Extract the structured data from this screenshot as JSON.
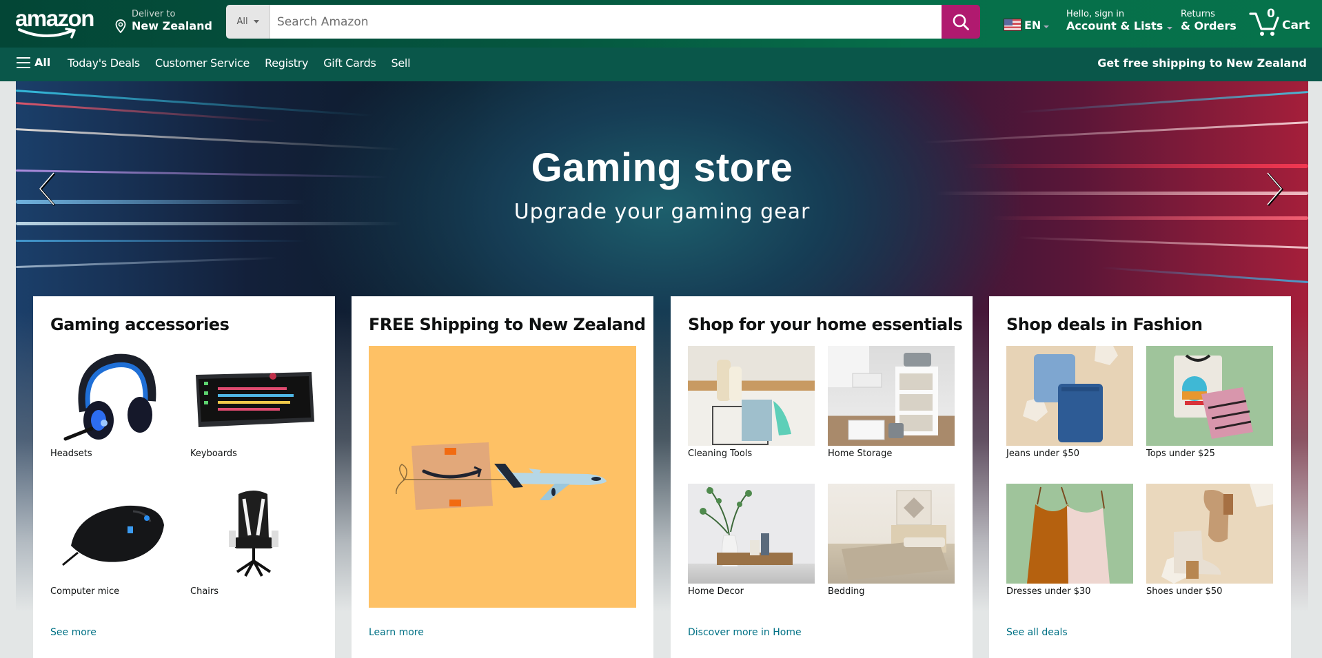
{
  "header": {
    "logo_text": "amazon",
    "deliver_line1": "Deliver to",
    "deliver_line2": "New Zealand",
    "search_category": "All",
    "search_placeholder": "Search Amazon",
    "search_value": "",
    "language": "EN",
    "account_line1": "Hello, sign in",
    "account_line2": "Account & Lists",
    "returns_line1": "Returns",
    "returns_line2": "& Orders",
    "cart_count": "0",
    "cart_label": "Cart"
  },
  "nav": {
    "all_label": "All",
    "links": [
      "Today's Deals",
      "Customer Service",
      "Registry",
      "Gift Cards",
      "Sell"
    ],
    "promo": "Get free shipping to New Zealand"
  },
  "hero": {
    "title": "Gaming store",
    "subtitle": "Upgrade your gaming gear"
  },
  "cards": [
    {
      "title": "Gaming accessories",
      "items": [
        {
          "label": "Headsets"
        },
        {
          "label": "Keyboards"
        },
        {
          "label": "Computer mice"
        },
        {
          "label": "Chairs"
        }
      ],
      "link": "See more"
    },
    {
      "title": "FREE Shipping to New Zealand",
      "link": "Learn more"
    },
    {
      "title": "Shop for your home essentials",
      "items": [
        {
          "label": "Cleaning Tools"
        },
        {
          "label": "Home Storage"
        },
        {
          "label": "Home Decor"
        },
        {
          "label": "Bedding"
        }
      ],
      "link": "Discover more in Home"
    },
    {
      "title": "Shop deals in Fashion",
      "items": [
        {
          "label": "Jeans under $50"
        },
        {
          "label": "Tops under $25"
        },
        {
          "label": "Dresses under $30"
        },
        {
          "label": "Shoes under $50"
        }
      ],
      "link": "See all deals"
    }
  ],
  "colors": {
    "header_bg": "#05563f",
    "nav_bg": "#0a574a",
    "search_button": "#b01a6f",
    "link": "#007185",
    "shipping_bg": "#fec165"
  }
}
